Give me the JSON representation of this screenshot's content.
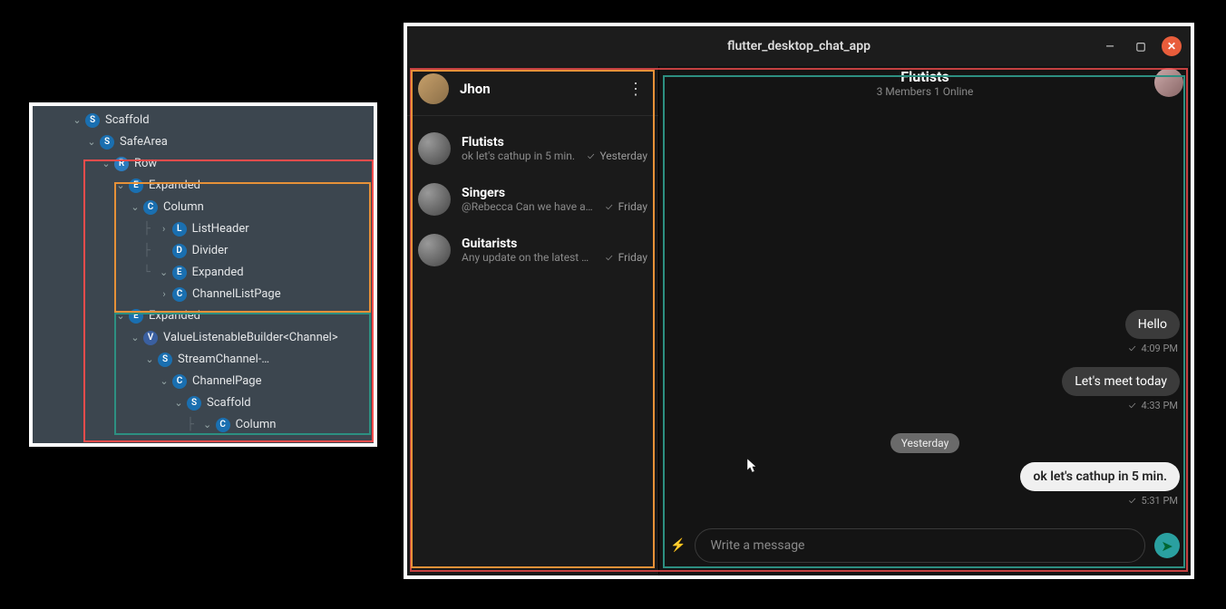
{
  "widget_tree": {
    "nodes": [
      {
        "depth": 0,
        "open": true,
        "badge": "S",
        "label": "Scaffold"
      },
      {
        "depth": 1,
        "open": true,
        "badge": "S",
        "label": "SafeArea"
      },
      {
        "depth": 2,
        "open": true,
        "badge": "R",
        "label": "Row"
      },
      {
        "depth": 3,
        "open": true,
        "badge": "E",
        "label": "Expanded"
      },
      {
        "depth": 4,
        "open": true,
        "badge": "C",
        "label": "Column"
      },
      {
        "depth": 5,
        "open": false,
        "badge": "L",
        "label": "ListHeader",
        "pipe": true
      },
      {
        "depth": 5,
        "open": false,
        "badge": "D",
        "label": "Divider",
        "pipe": true,
        "noChev": true
      },
      {
        "depth": 5,
        "open": true,
        "badge": "E",
        "label": "Expanded",
        "pipe": true,
        "last": true
      },
      {
        "depth": 6,
        "open": false,
        "badge": "C",
        "label": "ChannelListPage"
      },
      {
        "depth": 3,
        "open": true,
        "badge": "E",
        "label": "Expanded"
      },
      {
        "depth": 4,
        "open": true,
        "badge": "V",
        "label": "ValueListenableBuilder<Channel>"
      },
      {
        "depth": 5,
        "open": true,
        "badge": "S",
        "label": "StreamChannel-…"
      },
      {
        "depth": 6,
        "open": true,
        "badge": "C",
        "label": "ChannelPage"
      },
      {
        "depth": 7,
        "open": true,
        "badge": "S",
        "label": "Scaffold"
      },
      {
        "depth": 8,
        "open": true,
        "badge": "C",
        "label": "Column",
        "pipe8": true
      }
    ]
  },
  "app": {
    "window_title": "flutter_desktop_chat_app",
    "sidebar": {
      "user_name": "Jhon",
      "channels": [
        {
          "name": "Flutists",
          "sub": "ok let's cathup in 5 min.",
          "time": "Yesterday"
        },
        {
          "name": "Singers",
          "sub": "@Rebecca Can we have a…",
          "time": "Friday"
        },
        {
          "name": "Guitarists",
          "sub": "Any update on the latest …",
          "time": "Friday"
        }
      ]
    },
    "chat": {
      "room_name": "Flutists",
      "room_sub": "3 Members 1 Online",
      "day_separator": "Yesterday",
      "messages": [
        {
          "text": "Hello",
          "stamp": "4:09 PM",
          "style": "dark"
        },
        {
          "text": "Let's meet today",
          "stamp": "4:33 PM",
          "style": "dark"
        },
        {
          "text": "ok let's cathup in 5 min.",
          "stamp": "5:31 PM",
          "style": "light"
        }
      ],
      "compose_placeholder": "Write a message"
    }
  }
}
